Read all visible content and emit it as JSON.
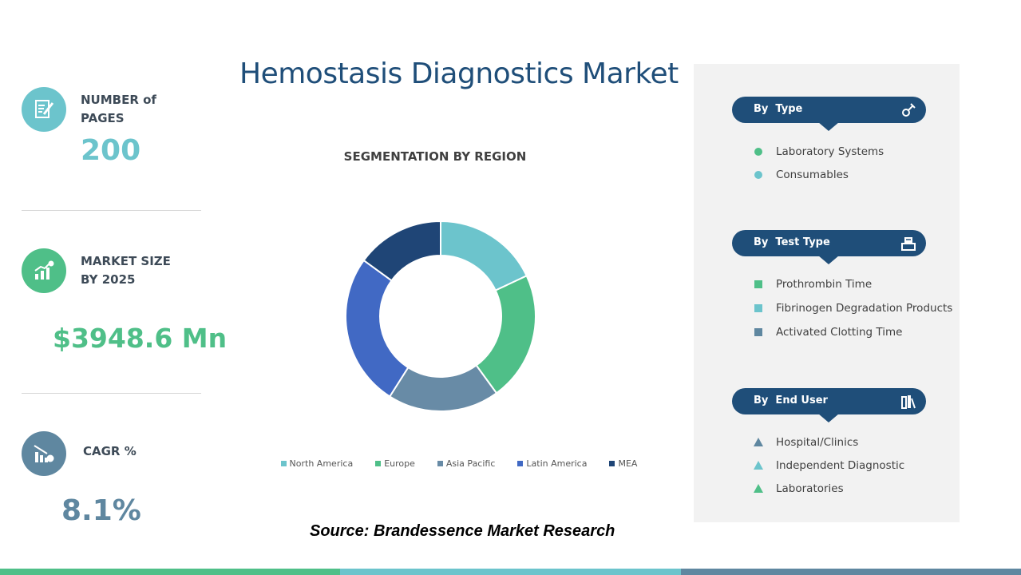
{
  "title": "Hemostasis Diagnostics Market",
  "stats": {
    "pages": {
      "label": "NUMBER of\nPAGES",
      "value": "200"
    },
    "market_size": {
      "label": "MARKET SIZE\nBY 2025",
      "value": "$3948.6 Mn"
    },
    "cagr": {
      "label": "CAGR %",
      "value": "8.1%"
    }
  },
  "colors": {
    "teal": "#6cc4cc",
    "green": "#4fbf88",
    "slate": "#5f87a0",
    "navy": "#1f4e79",
    "blue": "#4169c4",
    "dark_navy": "#1f4576"
  },
  "chart_data": {
    "type": "pie",
    "title": "SEGMENTATION  BY REGION",
    "categories": [
      "North America",
      "Europe",
      "Asia Pacific",
      "Latin America",
      "MEA"
    ],
    "values": [
      18,
      22,
      19,
      26,
      15
    ],
    "colors": [
      "#6cc4cc",
      "#4fbf88",
      "#688ba6",
      "#4169c4",
      "#1f4576"
    ],
    "legend_position": "bottom"
  },
  "segments": {
    "by_type": {
      "title": "By  Type",
      "icon": "gear-wrench-icon",
      "items": [
        "Laboratory Systems",
        "Consumables"
      ]
    },
    "by_test_type": {
      "title": "By  Test Type",
      "icon": "test-box-icon",
      "items": [
        "Prothrombin  Time",
        "Fibrinogen Degradation Products",
        "Activated Clotting Time"
      ]
    },
    "by_end_user": {
      "title": "By  End User",
      "icon": "building-icon",
      "items": [
        "Hospital/Clinics",
        "Independent  Diagnostic",
        "Laboratories"
      ]
    }
  },
  "source": "Source: Brandessence Market Research"
}
